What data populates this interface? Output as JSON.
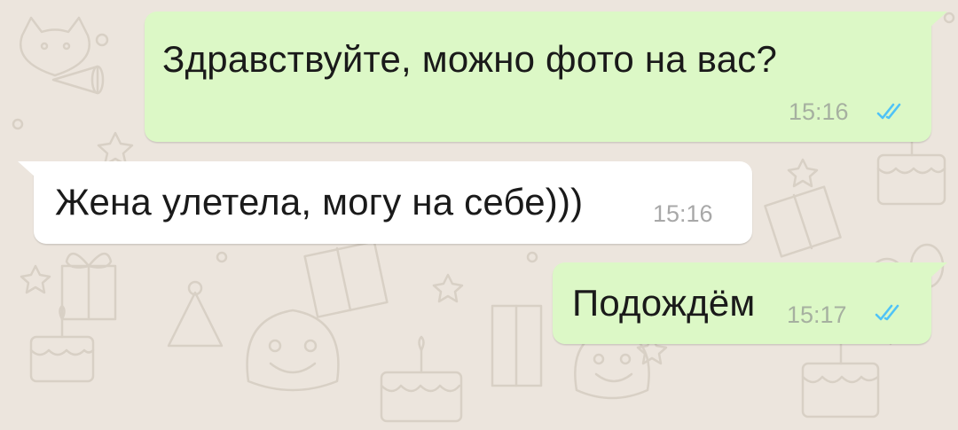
{
  "chat": {
    "messages": [
      {
        "direction": "outgoing",
        "text": "Здравствуйте, можно фото на вас?",
        "time": "15:16",
        "status_icon": "double-check-read-icon"
      },
      {
        "direction": "incoming",
        "text": "Жена улетела, могу на себе)))",
        "time": "15:16"
      },
      {
        "direction": "outgoing",
        "text": "Подождём",
        "time": "15:17",
        "status_icon": "double-check-read-icon"
      }
    ]
  },
  "colors": {
    "background": "#ece5dd",
    "outgoing_bubble": "#dcf8c6",
    "incoming_bubble": "#ffffff",
    "read_tick": "#4fc3f7",
    "doodle_stroke": "#d9d1c7"
  }
}
